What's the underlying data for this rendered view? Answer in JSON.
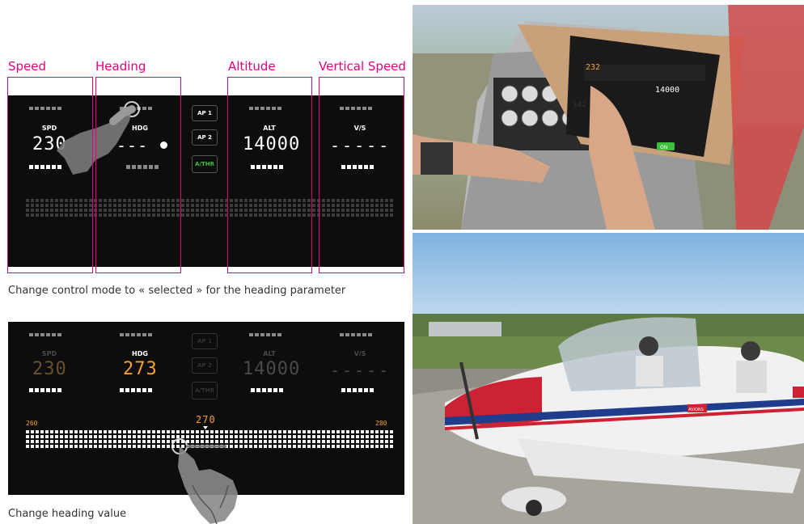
{
  "top_labels": {
    "speed": "Speed",
    "heading": "Heading",
    "altitude": "Altitude",
    "vertical_speed": "Vertical Speed"
  },
  "panel1": {
    "spd_label": "SPD",
    "spd_value": "230",
    "hdg_label": "HDG",
    "hdg_value": "---",
    "alt_label": "ALT",
    "alt_value": "14000",
    "vs_label": "V/S",
    "vs_value": "-----",
    "ap1": "AP 1",
    "ap2": "AP 2",
    "athr": "A/THR"
  },
  "caption1": "Change control mode to « selected » for the heading parameter",
  "panel2": {
    "spd_label": "SPD",
    "spd_value": "230",
    "hdg_label": "HDG",
    "hdg_value": "273",
    "alt_label": "ALT",
    "alt_value": "14000",
    "vs_label": "V/S",
    "vs_value": "-----",
    "ap1": "AP 1",
    "ap2": "AP 2",
    "athr": "A/THR",
    "scale_left": "260",
    "scale_center": "270",
    "scale_right": "280"
  },
  "caption2": "Change heading value",
  "colors": {
    "annotation_pink": "#e4007c",
    "panel_bg": "#0d0d0d",
    "active_white": "#ffffff",
    "selected_orange": "#f5a030",
    "athr_green": "#3fbf3f",
    "dim_gray": "#4a4a4a"
  },
  "icons": {
    "gesture_hand": "hand-pointer-icon",
    "selected_dot": "dot-icon"
  },
  "photos": {
    "cockpit_tablet_label": "142",
    "cockpit_button": "ON",
    "plane_markings": "AVIONS"
  }
}
